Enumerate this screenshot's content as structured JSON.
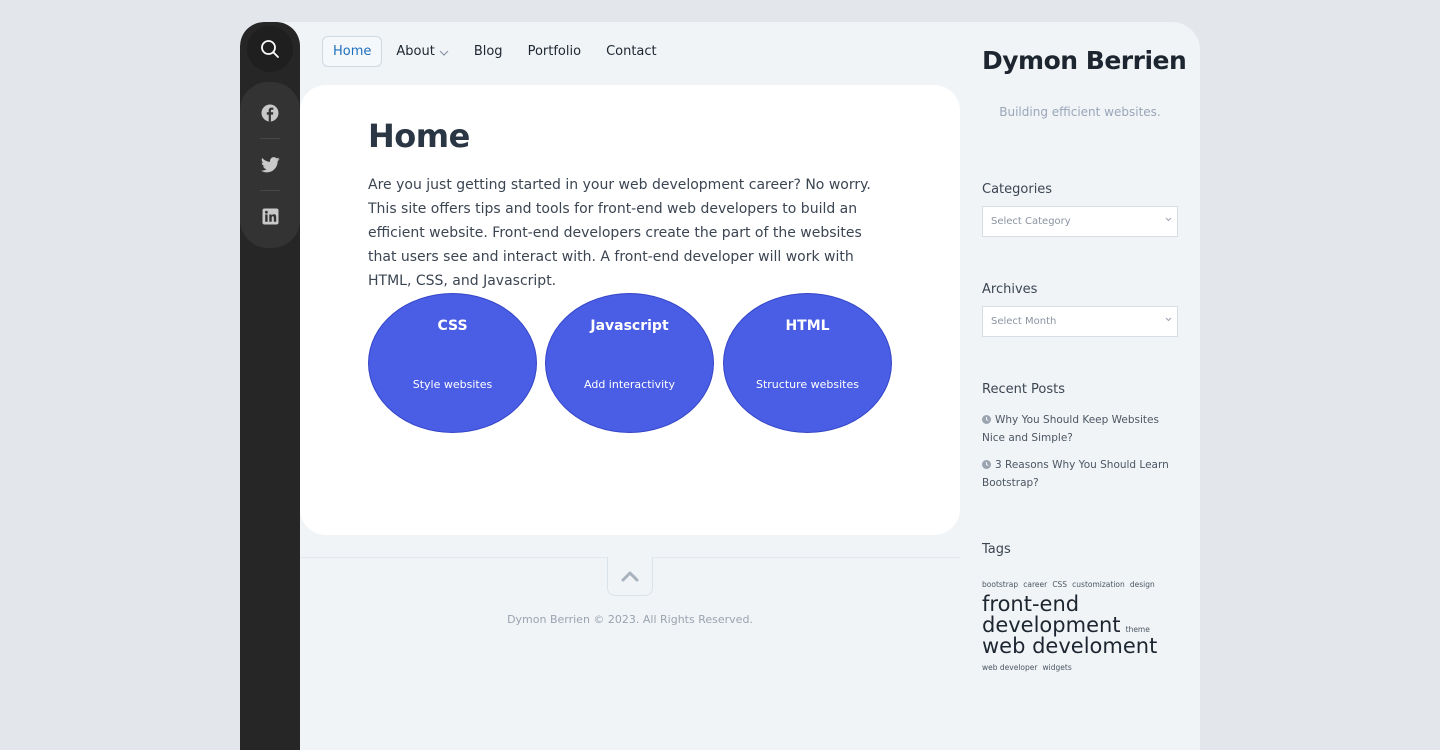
{
  "rail": {
    "search_icon": "search-icon",
    "social": [
      "facebook-icon",
      "twitter-icon",
      "linkedin-icon"
    ]
  },
  "nav": {
    "home": "Home",
    "about": "About",
    "blog": "Blog",
    "portfolio": "Portfolio",
    "contact": "Contact"
  },
  "main": {
    "title": "Home",
    "intro": "Are you just getting started in your web development career? No worry. This site offers tips and tools for front-end web developers to build an efficient website. Front-end developers create the part of the websites that users see and interact with. A front-end developer will work with HTML, CSS, and Javascript.",
    "cards": [
      {
        "title": "CSS",
        "subtitle": "Style websites"
      },
      {
        "title": "Javascript",
        "subtitle": "Add interactivity"
      },
      {
        "title": "HTML",
        "subtitle": "Structure websites"
      }
    ],
    "accent_color": "#4a5de5"
  },
  "footer": {
    "copyright": "Dymon Berrien © 2023. All Rights Reserved."
  },
  "sidebar": {
    "site_title": "Dymon Berrien",
    "tagline": "Building efficient websites.",
    "categories": {
      "title": "Categories",
      "selected": "Select Category"
    },
    "archives": {
      "title": "Archives",
      "selected": "Select Month"
    },
    "recent_posts": {
      "title": "Recent Posts",
      "items": [
        "Why You Should Keep Websites Nice and Simple?",
        "3 Reasons Why You Should Learn Bootstrap?"
      ]
    },
    "tags": {
      "title": "Tags",
      "bootstrap": "bootstrap",
      "career": "career",
      "css": "CSS",
      "customization": "customization",
      "design": "design",
      "front_end_development": "front-end development",
      "theme": "theme",
      "web_develoment": "web develoment",
      "web_developer": "web developer",
      "widgets": "widgets"
    }
  }
}
